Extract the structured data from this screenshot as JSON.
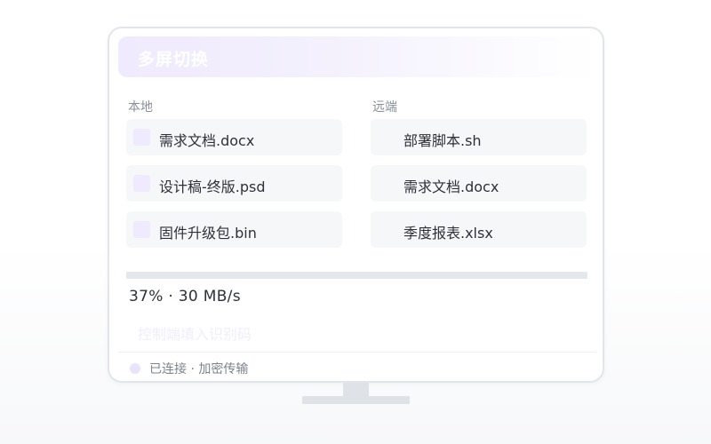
{
  "header": {
    "title": "多屏切换"
  },
  "local": {
    "label": "本地",
    "files": [
      {
        "name": "需求文档.docx",
        "icon": "file-icon"
      },
      {
        "name": "设计稿-终版.psd",
        "icon": "file-icon"
      },
      {
        "name": "固件升级包.bin",
        "icon": "file-icon"
      }
    ]
  },
  "remote": {
    "label": "远端",
    "files": [
      {
        "name": "部署脚本.sh"
      },
      {
        "name": "需求文档.docx"
      },
      {
        "name": "季度报表.xlsx"
      }
    ]
  },
  "transfer": {
    "progress_percent": 37,
    "status_text": "37% · 30 MB/s"
  },
  "code_input": {
    "placeholder": "控制端填入识别码"
  },
  "footer": {
    "status": "已连接 · 加密传输"
  },
  "colors": {
    "accent_light": "#efeafd",
    "border": "#e2e5ea",
    "item_bg": "#f6f7f9",
    "text": "#2d3139",
    "muted": "#8a8f98"
  }
}
